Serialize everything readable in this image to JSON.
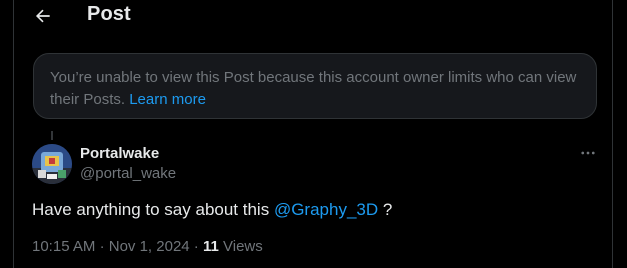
{
  "header": {
    "title": "Post",
    "back_icon": "arrow-left-icon"
  },
  "notice": {
    "text": "You’re unable to view this Post because this account owner limits who can view their Posts.",
    "link_label": "Learn more"
  },
  "post": {
    "author_name": "Portalwake",
    "author_handle": "@portal_wake",
    "text_before": "Have anything to say about this ",
    "mention": "@Graphy_3D",
    "text_after": " ?",
    "time": "10:15 AM",
    "separator": "·",
    "date": "Nov 1, 2024",
    "views_count": "11",
    "views_label": "Views",
    "more_icon": "more-horizontal-icon"
  },
  "colors": {
    "background": "#000000",
    "text": "#e7e9ea",
    "muted": "#71767b",
    "accent": "#1d9bf0",
    "border": "#2f3336",
    "notice_bg": "#16181c"
  }
}
